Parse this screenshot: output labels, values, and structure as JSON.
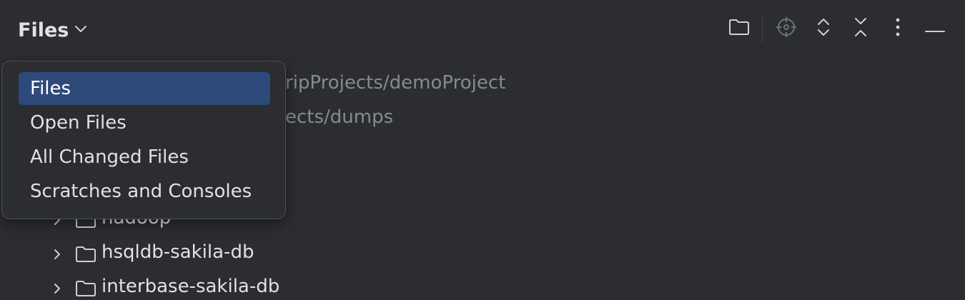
{
  "header": {
    "title": "Files"
  },
  "toolbar": {
    "buttons": [
      {
        "name": "select-opened-file",
        "icon": "folder-icon"
      },
      {
        "name": "locate",
        "icon": "crosshair-icon"
      },
      {
        "name": "expand-all",
        "icon": "expand-icon"
      },
      {
        "name": "collapse-all",
        "icon": "collapse-icon"
      },
      {
        "name": "options",
        "icon": "more-vertical-icon"
      },
      {
        "name": "hide",
        "icon": "minimize-icon"
      }
    ]
  },
  "tree": {
    "roots": [
      {
        "path_visible": "ripProjects/demoProject"
      },
      {
        "path_visible": "ects/dumps"
      }
    ],
    "folders": [
      {
        "name": "hadoop"
      },
      {
        "name": "hsqldb-sakila-db"
      },
      {
        "name": "interbase-sakila-db"
      }
    ]
  },
  "popup": {
    "items": [
      {
        "label": "Files",
        "selected": true
      },
      {
        "label": "Open Files",
        "selected": false
      },
      {
        "label": "All Changed Files",
        "selected": false
      },
      {
        "label": "Scratches and Consoles",
        "selected": false
      }
    ]
  },
  "colors": {
    "background": "#2b2d30",
    "text": "#dfe1e5",
    "muted_text": "#868a91",
    "selection": "#2e4a7a",
    "icon": "#ced0d6",
    "disabled_icon": "#6f737a"
  }
}
